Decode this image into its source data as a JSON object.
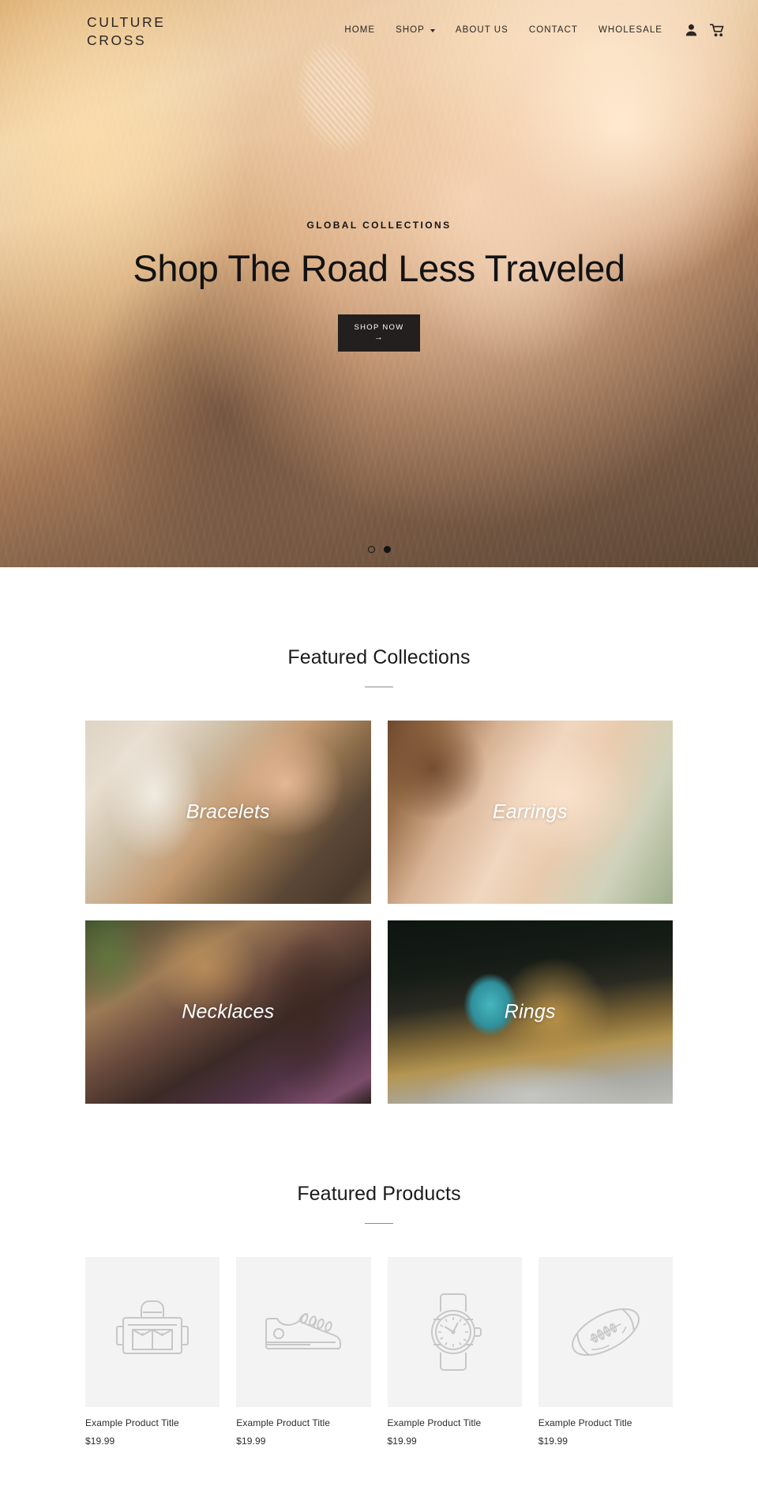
{
  "site": {
    "logo": "CULTURE\nCROSS"
  },
  "nav": {
    "items": [
      {
        "label": "HOME",
        "has_dropdown": false
      },
      {
        "label": "SHOP",
        "has_dropdown": true
      },
      {
        "label": "ABOUT US",
        "has_dropdown": false
      },
      {
        "label": "CONTACT",
        "has_dropdown": false
      },
      {
        "label": "WHOLESALE",
        "has_dropdown": false
      }
    ],
    "icons": [
      {
        "name": "account-icon"
      },
      {
        "name": "cart-icon"
      }
    ]
  },
  "hero": {
    "eyebrow": "GLOBAL COLLECTIONS",
    "title": "Shop The Road Less Traveled",
    "button_label": "SHOP NOW",
    "button_arrow": "→",
    "slides": [
      {
        "active": false
      },
      {
        "active": true
      }
    ]
  },
  "featured_collections": {
    "title": "Featured Collections",
    "items": [
      {
        "label": "Bracelets",
        "image_class": "img-bracelets"
      },
      {
        "label": "Earrings",
        "image_class": "img-earrings"
      },
      {
        "label": "Necklaces",
        "image_class": "img-necklaces"
      },
      {
        "label": "Rings",
        "image_class": "img-rings"
      }
    ]
  },
  "featured_products": {
    "title": "Featured Products",
    "items": [
      {
        "title": "Example Product Title",
        "price": "$19.99",
        "icon": "briefcase-icon"
      },
      {
        "title": "Example Product Title",
        "price": "$19.99",
        "icon": "sneaker-icon"
      },
      {
        "title": "Example Product Title",
        "price": "$19.99",
        "icon": "watch-icon"
      },
      {
        "title": "Example Product Title",
        "price": "$19.99",
        "icon": "football-icon"
      }
    ]
  },
  "colors": {
    "text": "#1c1b1b",
    "button_bg": "#231f1f",
    "button_text": "#ffffff",
    "placeholder_thumb": "#f3f3f3",
    "placeholder_icon": "#c7c7c7"
  }
}
